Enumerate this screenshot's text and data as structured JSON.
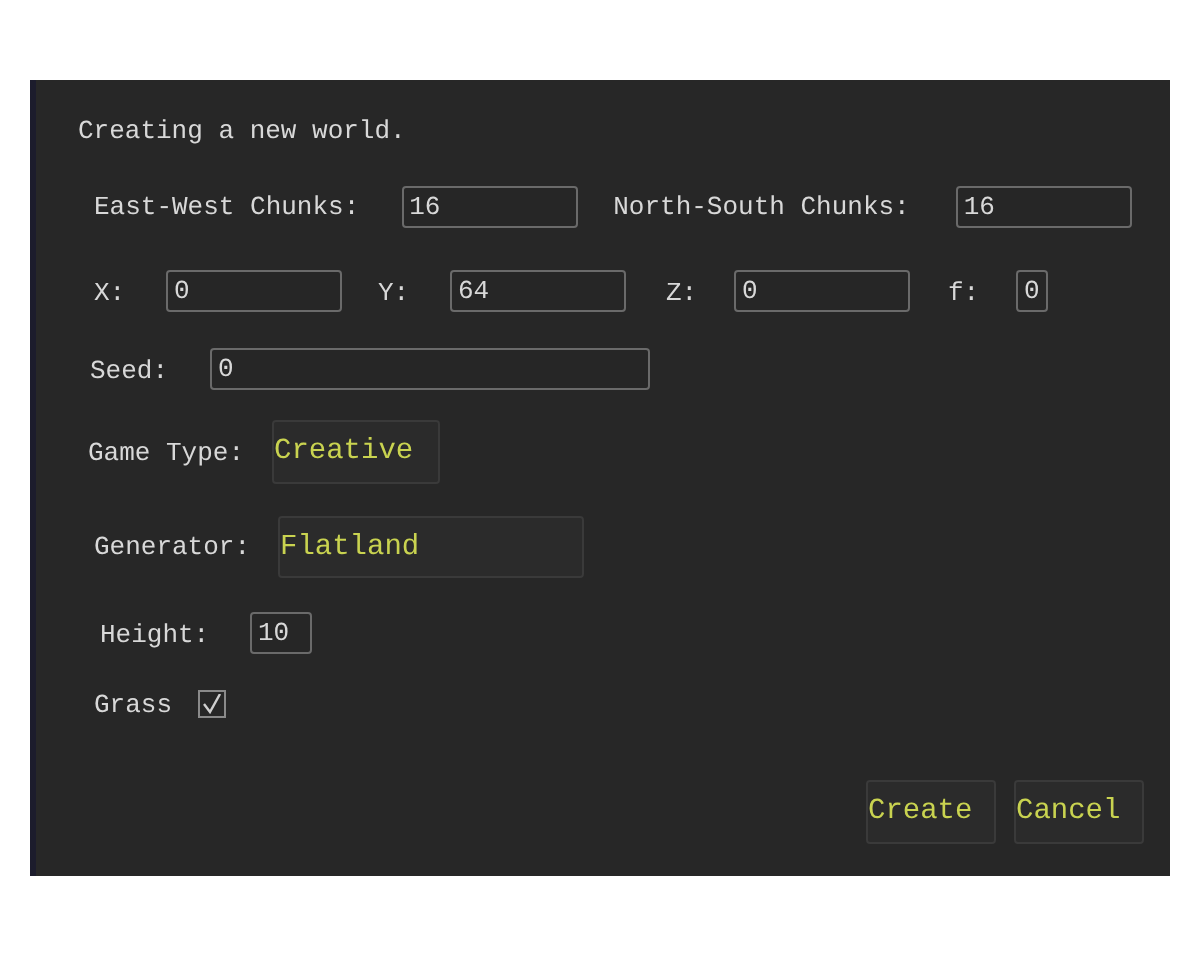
{
  "title": "Creating a new world.",
  "chunk_fields": [
    {
      "label": "East-West Chunks:",
      "value": "16"
    },
    {
      "label": "North-South Chunks:",
      "value": "16"
    }
  ],
  "coords": [
    {
      "label": "X:",
      "value": "0"
    },
    {
      "label": "Y:",
      "value": "64"
    },
    {
      "label": "Z:",
      "value": "0"
    },
    {
      "label": "f:",
      "value": "0"
    }
  ],
  "seed": {
    "label": "Seed:",
    "value": "0"
  },
  "game_type": {
    "label": "Game Type:",
    "value": "Creative"
  },
  "generator": {
    "label": "Generator:",
    "value": "Flatland"
  },
  "height": {
    "label": "Height:",
    "value": "10"
  },
  "grass": {
    "label": "Grass",
    "checked": true
  },
  "buttons": [
    "Create",
    "Cancel"
  ]
}
